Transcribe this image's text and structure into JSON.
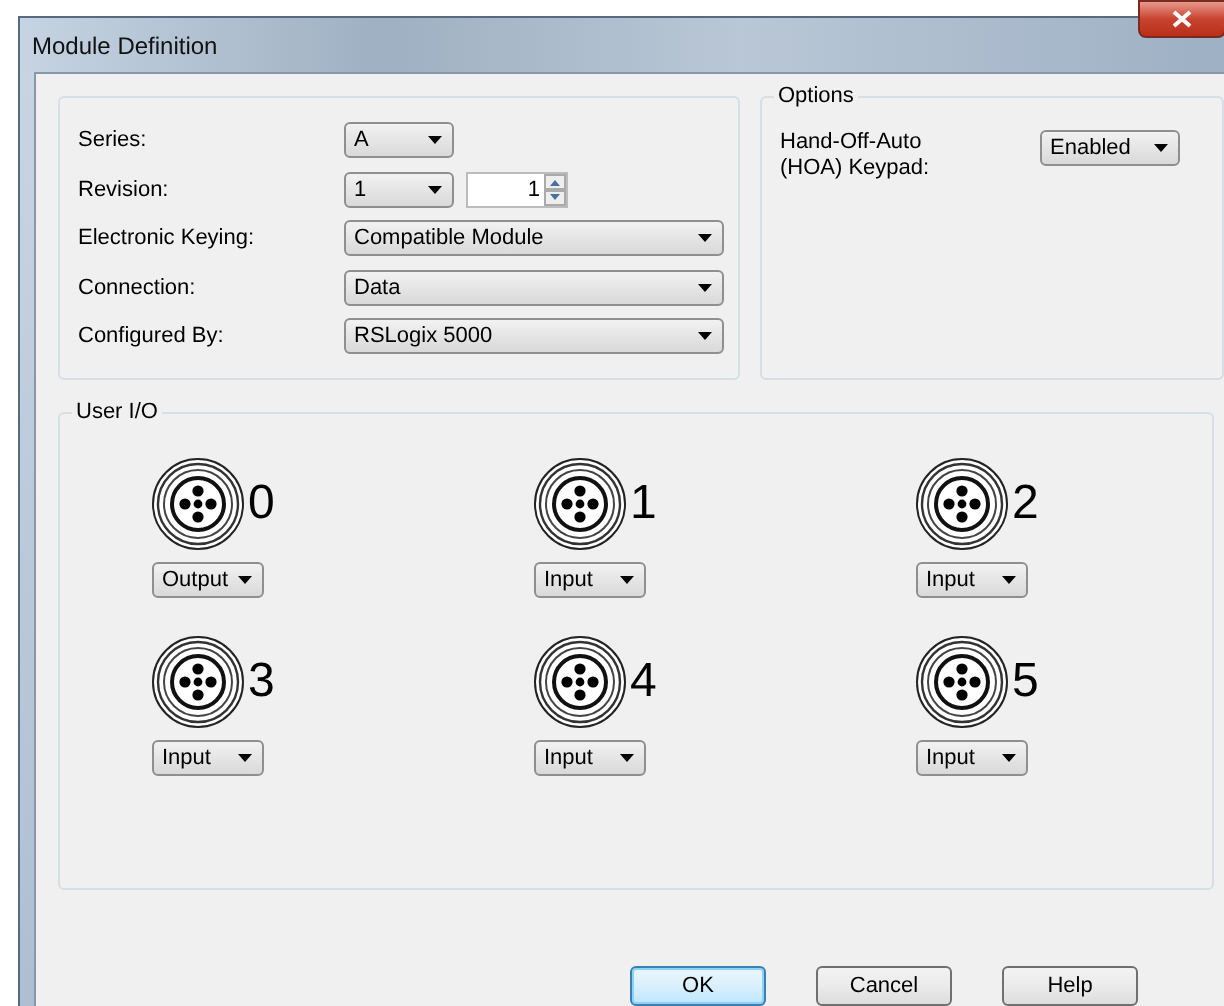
{
  "window": {
    "title": "Module Definition"
  },
  "general": {
    "fields": [
      {
        "label": "Series:",
        "kind": "short",
        "value": "A"
      },
      {
        "label": "Revision:",
        "kind": "spin",
        "value": "1",
        "spin_value": "1"
      },
      {
        "label": "Electronic Keying:",
        "kind": "wide",
        "value": "Compatible Module"
      },
      {
        "label": "Connection:",
        "kind": "wide",
        "value": "Data"
      },
      {
        "label": "Configured By:",
        "kind": "wide",
        "value": "RSLogix 5000"
      }
    ]
  },
  "options": {
    "title": "Options",
    "label": "Hand-Off-Auto\n(HOA) Keypad:",
    "value": "Enabled"
  },
  "user_io": {
    "title": "User I/O",
    "ports": [
      {
        "number": "0",
        "mode": "Output"
      },
      {
        "number": "1",
        "mode": "Input"
      },
      {
        "number": "2",
        "mode": "Input"
      },
      {
        "number": "3",
        "mode": "Input"
      },
      {
        "number": "4",
        "mode": "Input"
      },
      {
        "number": "5",
        "mode": "Input"
      }
    ]
  },
  "buttons": [
    {
      "label": "OK",
      "default": true
    },
    {
      "label": "Cancel",
      "default": false
    },
    {
      "label": "Help",
      "default": false
    }
  ]
}
